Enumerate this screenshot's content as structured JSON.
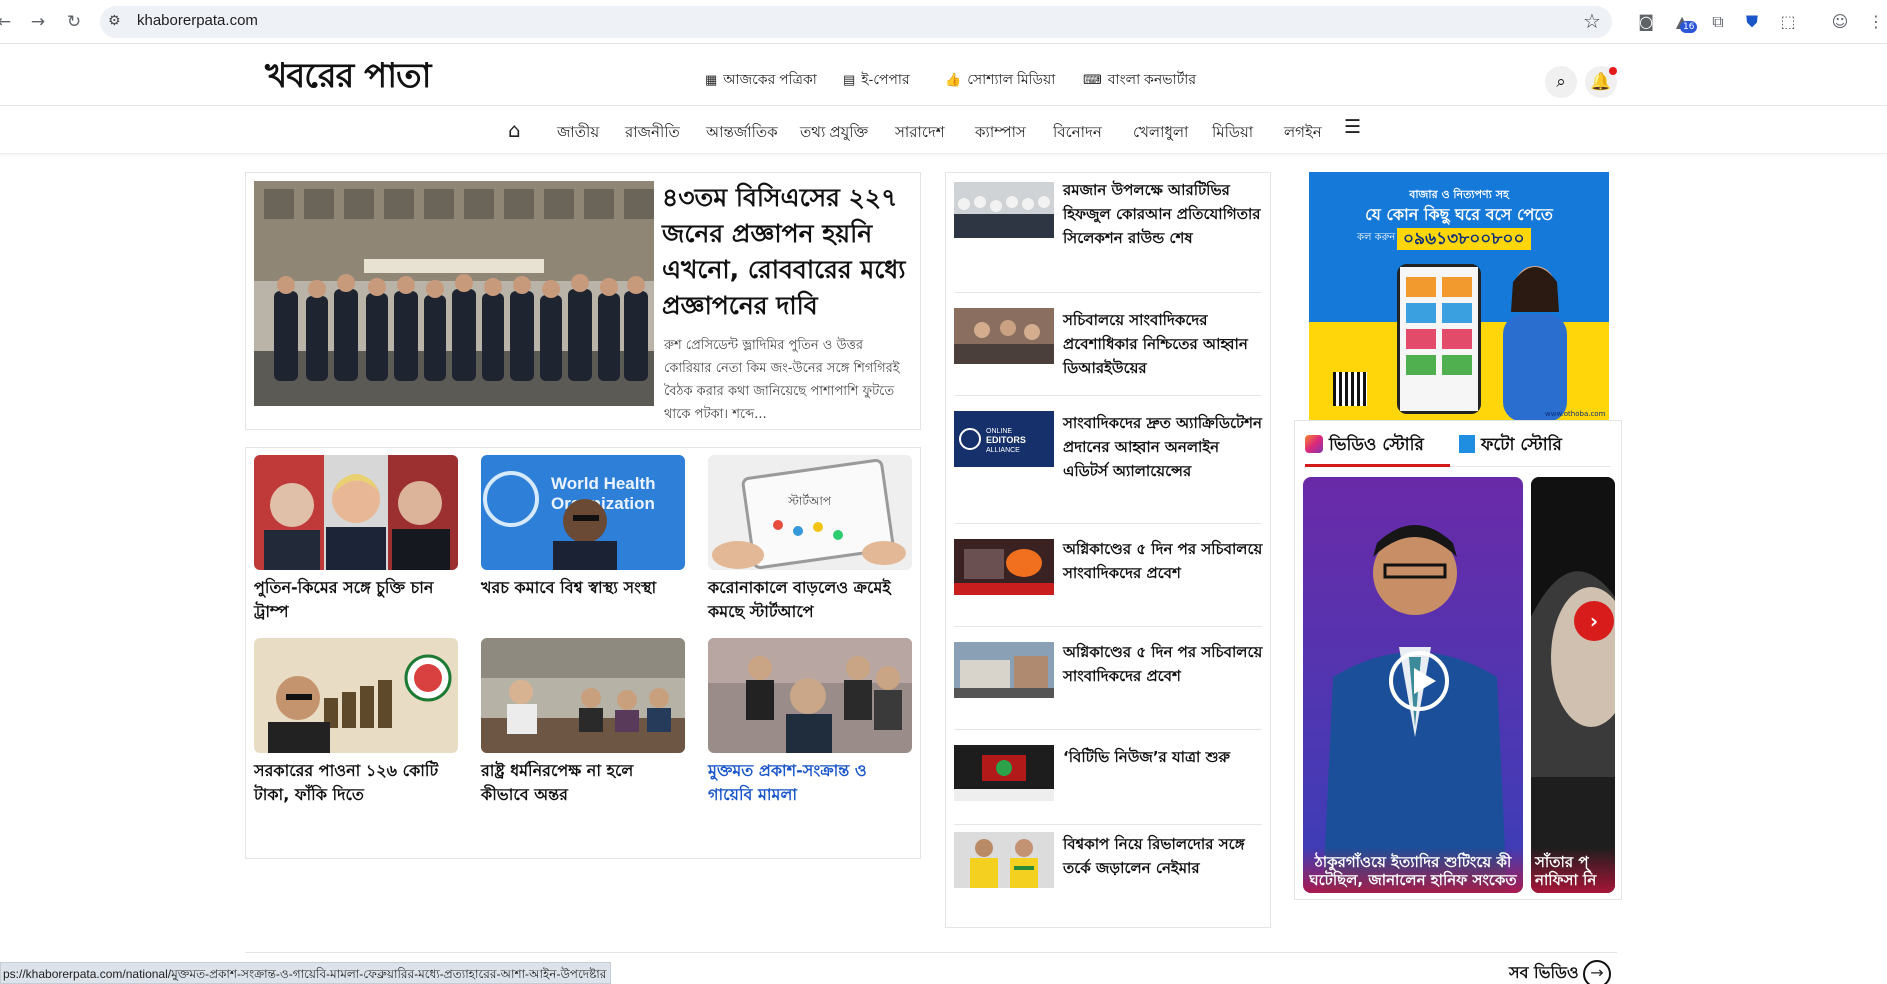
{
  "browser": {
    "url": "khaborerpata.com",
    "extension_badge": "16"
  },
  "site": {
    "logo": "খবরের পাতা",
    "header_links": [
      {
        "label": "আজকের পত্রিকা",
        "icon": "newspaper-icon"
      },
      {
        "label": "ই-পেপার",
        "icon": "epaper-icon"
      },
      {
        "label": "সোশ্যাল মিডিয়া",
        "icon": "thumbs-up-icon"
      },
      {
        "label": "বাংলা কনভার্টার",
        "icon": "converter-icon"
      }
    ],
    "nav": [
      "জাতীয়",
      "রাজনীতি",
      "আন্তর্জাতিক",
      "তথ্য প্রযুক্তি",
      "সারাদেশ",
      "ক্যাম্পাস",
      "বিনোদন",
      "খেলাধুলা",
      "মিডিয়া",
      "লগইন"
    ]
  },
  "lead": {
    "title": "৪৩তম বিসিএসের ২২৭ জনের প্রজ্ঞাপন হয়নি এখনো, রোববারের মধ্যে প্রজ্ঞাপনের দাবি",
    "summary": "রুশ প্রেসিডেন্ট ভ্লাদিমির পুতিন ও উত্তর কোরিয়ার নেতা কিম জং-উনের সঙ্গে শিগগিরই বৈঠক করার কথা জানিয়েছে পাশাপাশি ফুটতে থাকে পটকা। শব্দে..."
  },
  "grid": [
    {
      "title": "পুতিন-কিমের সঙ্গে চুক্তি চান ট্রাম্প"
    },
    {
      "title": "খরচ কমাবে বিশ্ব স্বাস্থ্য সংস্থা",
      "thumb_text": "World Health Organization"
    },
    {
      "title": "করোনাকালে বাড়লেও ক্রমেই কমছে স্টার্টআপে",
      "thumb_text": "স্টার্টআপ"
    },
    {
      "title": "সরকারের পাওনা ১২৬ কোটি টাকা, ফাঁকি দিতে"
    },
    {
      "title": "রাষ্ট্র ধর্মনিরপেক্ষ না হলে কীভাবে অন্তর"
    },
    {
      "title": "মুক্তমত প্রকাশ-সংক্রান্ত ও গায়েবি মামলা"
    }
  ],
  "side": [
    {
      "title": "রমজান উপলক্ষে আরটিভির হিফজুল কোরআন প্রতিযোগিতার সিলেকশন রাউন্ড শেষ"
    },
    {
      "title": "সচিবালয়ে সাংবাদিকদের প্রবেশাধিকার নিশ্চিতের আহ্বান ডিআরইউয়ের"
    },
    {
      "title": "সাংবাদিকদের দ্রুত অ্যাক্রিডিটেশন প্রদানের আহ্বান অনলাইন এডিটর্স অ্যালায়েন্সের",
      "thumb_text": "ONLINE EDITORS ALLIANCE"
    },
    {
      "title": "অগ্নিকাণ্ডের ৫ দিন পর সচিবালয়ে সাংবাদিকদের প্রবেশ"
    },
    {
      "title": "অগ্নিকাণ্ডের ৫ দিন পর সচিবালয়ে সাংবাদিকদের প্রবেশ"
    },
    {
      "title": "‘বিটিভি নিউজ’র যাত্রা শুরু"
    },
    {
      "title": "বিশ্বকাপ নিয়ে রিভালদোর সঙ্গে তর্কে জড়ালেন নেইমার"
    }
  ],
  "ad": {
    "line1": "বাজার ও নিত্যপণ্য সহ",
    "line2": "যে কোন কিছু ঘরে বসে পেতে",
    "call_label": "কল করুন",
    "phone": "০৯৬১৩৮০০৮০০",
    "site": "www.othoba.com"
  },
  "stories": {
    "tab_video": "ভিডিও স্টোরি",
    "tab_photo": "ফটো স্টোরি",
    "items": [
      {
        "caption": "ঠাকুরগাঁওয়ে ইত্যাদির শুটিংয়ে কী ঘটেছিল, জানালেন হানিফ সংকেত"
      },
      {
        "caption": "সাঁতার প্ নাফিসা নি"
      }
    ]
  },
  "bottom": {
    "all_video": "সব ভিডিও",
    "status_url": "ps://khaborerpata.com/national/মুক্তমত-প্রকাশ-সংক্রান্ত-ও-গায়েবি-মামলা-ফেব্রুয়ারির-মধ্যে-প্রত্যাহারের-আশা-আইন-উপদেষ্টার"
  },
  "colors": {
    "accent_red": "#d21a1a",
    "link_blue": "#1a56c9",
    "ad_blue": "#1479d8",
    "ad_yellow": "#ffd60a"
  }
}
